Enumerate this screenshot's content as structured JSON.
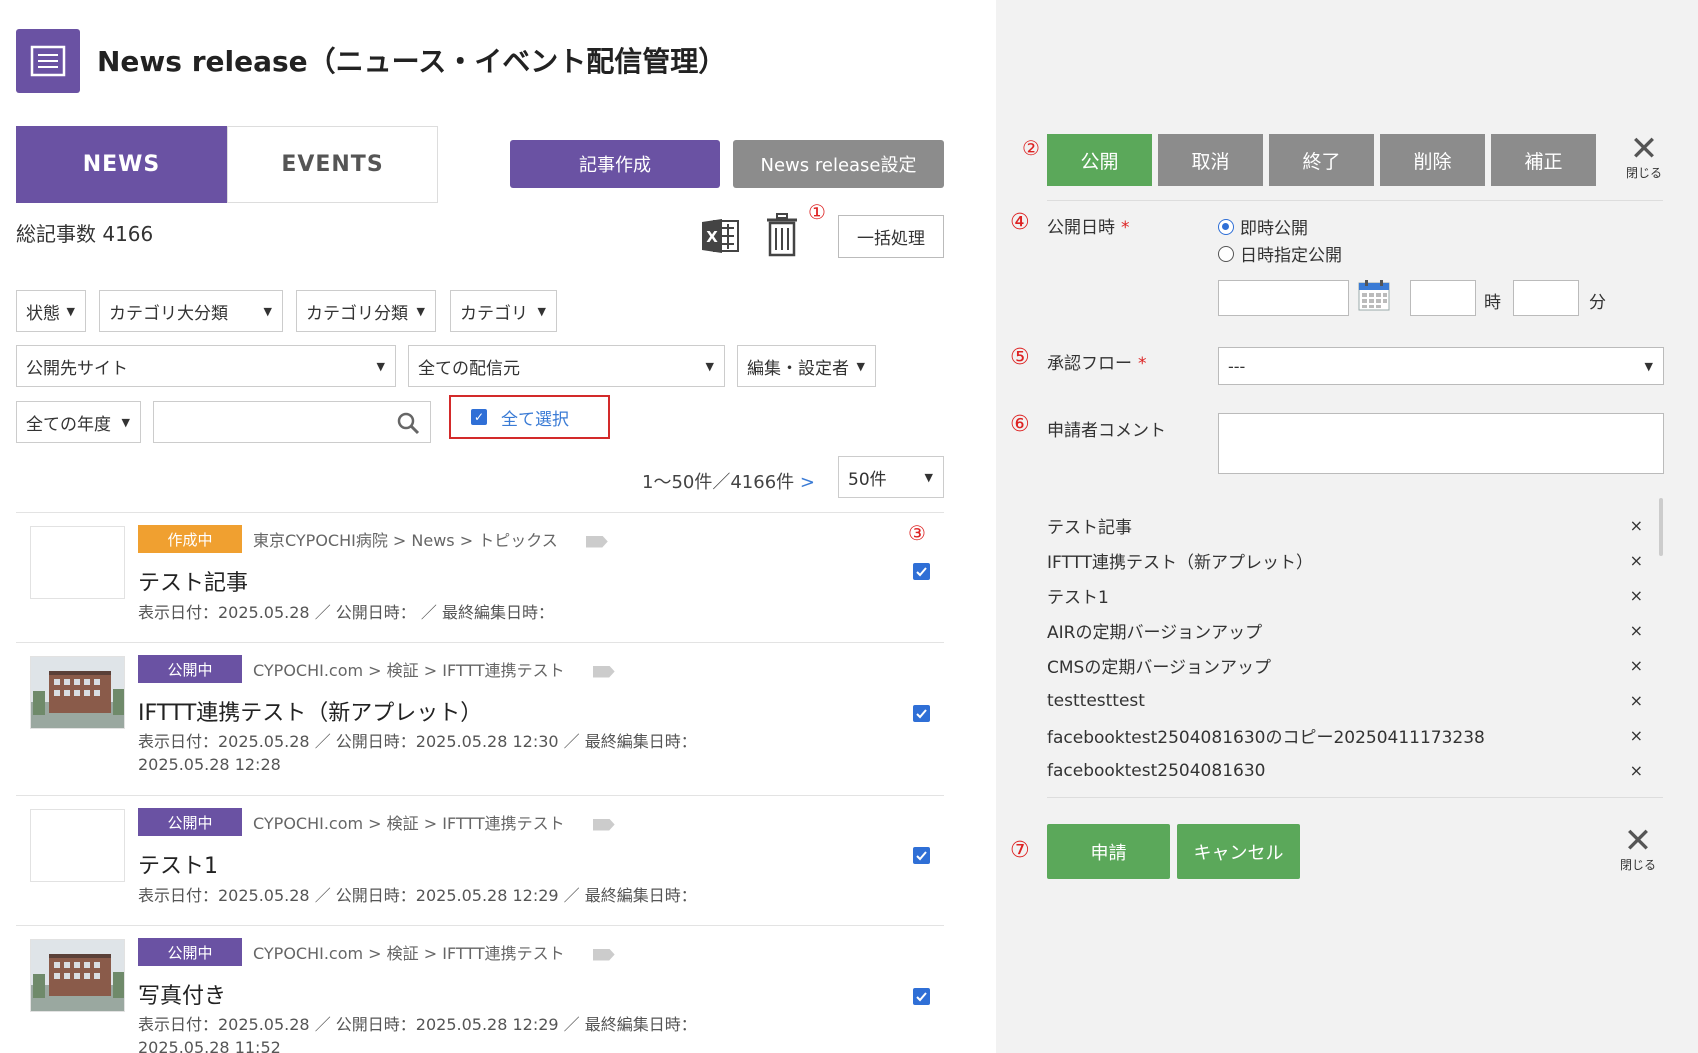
{
  "header": {
    "title": "News release（ニュース・イベント配信管理）"
  },
  "tabs": [
    {
      "label": "NEWS"
    },
    {
      "label": "EVENTS"
    }
  ],
  "toolbar": {
    "create_label": "記事作成",
    "settings_label": "News release設定",
    "bulk_label": "一括処理",
    "marker1": "①"
  },
  "summary": {
    "total": "総記事数 4166"
  },
  "filters": {
    "status": "状態",
    "cat_major": "カテゴリ大分類",
    "cat_class": "カテゴリ分類",
    "category": "カテゴリ",
    "site": "公開先サイト",
    "source": "全ての配信元",
    "editor": "編集・設定者",
    "year": "全ての年度",
    "select_all": "全て選択"
  },
  "pager": {
    "range": "1～50件／4166件",
    "next": ">",
    "per_page": "50件"
  },
  "articles": [
    {
      "status": "作成中",
      "status_type": "draft",
      "crumb": "東京CYPOCHI病院 > News > トピックス",
      "title": "テスト記事",
      "meta": "表示日付：2025.05.28 ／ 公開日時： ／ 最終編集日時：",
      "has_photo": false,
      "marker": "③"
    },
    {
      "status": "公開中",
      "status_type": "pub",
      "crumb": "CYPOCHI.com > 検証 > IFTTT連携テスト",
      "title": "IFTTT連携テスト（新アプレット）",
      "meta": "表示日付：2025.05.28 ／ 公開日時：2025.05.28 12:30 ／ 最終編集日時：2025.05.28 12:28",
      "has_photo": true
    },
    {
      "status": "公開中",
      "status_type": "pub",
      "crumb": "CYPOCHI.com > 検証 > IFTTT連携テスト",
      "title": "テスト1",
      "meta": "表示日付：2025.05.28 ／ 公開日時：2025.05.28 12:29 ／ 最終編集日時：",
      "has_photo": false
    },
    {
      "status": "公開中",
      "status_type": "pub",
      "crumb": "CYPOCHI.com > 検証 > IFTTT連携テスト",
      "title": "写真付き",
      "meta": "表示日付：2025.05.28 ／ 公開日時：2025.05.28 12:29 ／ 最終編集日時：2025.05.28 11:52",
      "has_photo": true
    }
  ],
  "panel": {
    "marker2": "②",
    "actions": [
      "公開",
      "取消",
      "終了",
      "削除",
      "補正"
    ],
    "close_label": "閉じる",
    "publish_date": {
      "marker": "④",
      "label": "公開日時",
      "req": "*",
      "opt_now": "即時公開",
      "opt_specify": "日時指定公開",
      "hour_label": "時",
      "min_label": "分"
    },
    "flow": {
      "marker": "⑤",
      "label": "承認フロー",
      "req": "*",
      "value": "---"
    },
    "comment": {
      "marker": "⑥",
      "label": "申請者コメント"
    },
    "selected": [
      "テスト記事",
      "IFTTT連携テスト（新アプレット）",
      "テスト1",
      "AIRの定期バージョンアップ",
      "CMSの定期バージョンアップ",
      "testtesttest",
      "facebooktest2504081630のコピー20250411173238",
      "facebooktest2504081630"
    ],
    "remove_symbol": "×",
    "marker7": "⑦",
    "apply_label": "申請",
    "cancel_label": "キャンセル"
  }
}
